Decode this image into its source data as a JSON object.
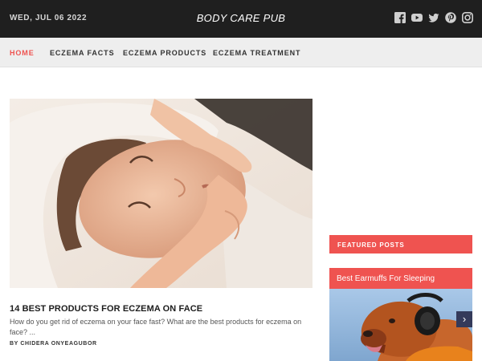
{
  "header": {
    "date": "WED, JUL 06 2022",
    "site_title": "BODY CARE PUB",
    "social_icons": [
      "facebook-icon",
      "youtube-icon",
      "twitter-icon",
      "pinterest-icon",
      "instagram-icon"
    ]
  },
  "nav": {
    "items": [
      {
        "label": "HOME",
        "active": true
      },
      {
        "label": "ECZEMA FACTS",
        "active": false
      },
      {
        "label": "ECZEMA PRODUCTS",
        "active": false
      },
      {
        "label": "ECZEMA TREATMENT",
        "active": false
      }
    ]
  },
  "main_post": {
    "title": "14 BEST PRODUCTS FOR ECZEMA ON FACE",
    "excerpt": "How do you get rid of eczema on your face fast? What are the best products for eczema on face? ...",
    "author": "BY CHIDERA ONYEAGUBOR"
  },
  "sidebar": {
    "featured_header": "FEATURED POSTS",
    "featured_posts": [
      {
        "title": "Best Earmuffs For Sleeping"
      }
    ],
    "next_arrow": "›"
  },
  "colors": {
    "accent": "#ef5350",
    "topbar": "#1f1f1f",
    "navbar": "#eeeeee",
    "arrow_bg": "#343a5a"
  }
}
